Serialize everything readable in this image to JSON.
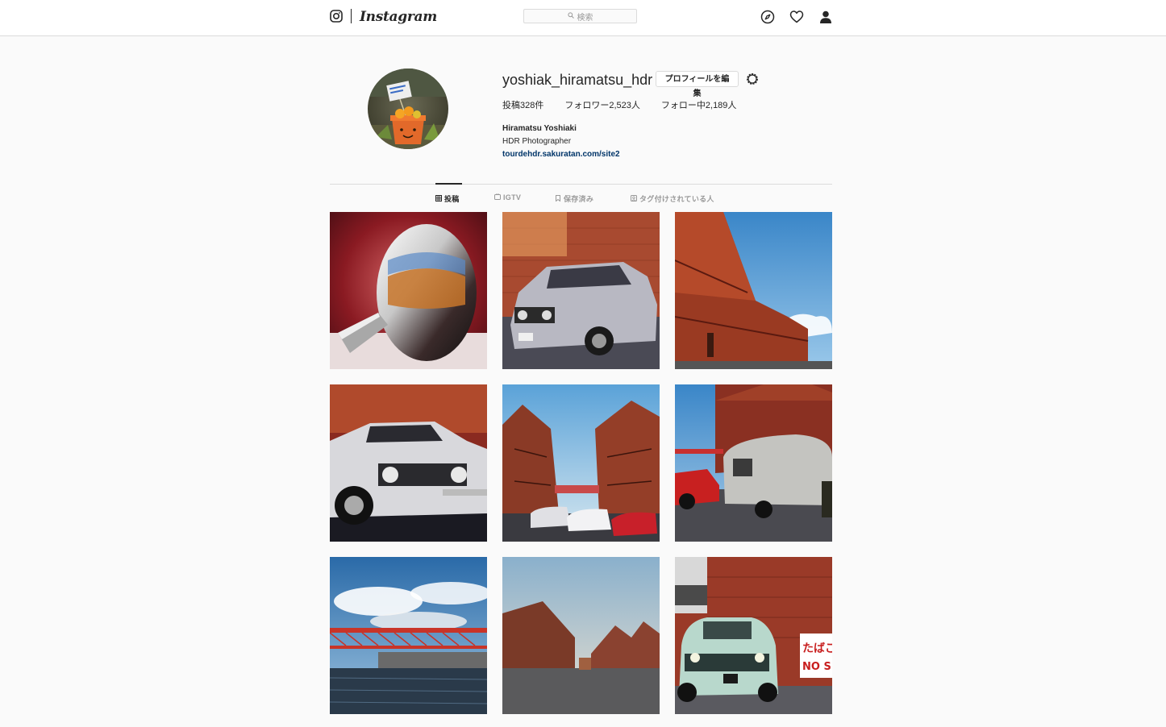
{
  "nav": {
    "wordmark": "Instagram",
    "search_placeholder": "検索",
    "icons": [
      "instagram-glyph-icon",
      "search-icon",
      "compass-icon",
      "heart-icon",
      "person-icon"
    ]
  },
  "profile": {
    "username": "yoshiak_hiramatsu_hdr",
    "edit_button": "プロフィールを編集",
    "stats": {
      "posts": "投稿328件",
      "followers": "フォロワー2,523人",
      "following": "フォロー中2,189人"
    },
    "full_name": "Hiramatsu Yoshiaki",
    "bio": "HDR Photographer",
    "website": "tourdehdr.sakuratan.com/site2"
  },
  "tabs": [
    {
      "label": "投稿",
      "icon": "grid-icon",
      "active": true
    },
    {
      "label": "IGTV",
      "icon": "tv-icon",
      "active": false
    },
    {
      "label": "保存済み",
      "icon": "bookmark-icon",
      "active": false
    },
    {
      "label": "タグ付けされている人",
      "icon": "tag-icon",
      "active": false
    }
  ],
  "posts": [
    {
      "subject": "chrome side mirror reflecting red brick warehouse"
    },
    {
      "subject": "silver vintage BMW sedan in front of brick wall"
    },
    {
      "subject": "red brick warehouses under blue sky"
    },
    {
      "subject": "white vintage Alfa Romeo coupe"
    },
    {
      "subject": "alley between brick warehouses with parked cars"
    },
    {
      "subject": "silver camping trailer and red truck"
    },
    {
      "subject": "red steel bridge over harbor"
    },
    {
      "subject": "brick warehouses at dusk"
    },
    {
      "subject": "light blue vintage compact car by brick wall with NO SMOKING sign",
      "visible_text": [
        "たばこの",
        "NO SMO"
      ]
    }
  ]
}
